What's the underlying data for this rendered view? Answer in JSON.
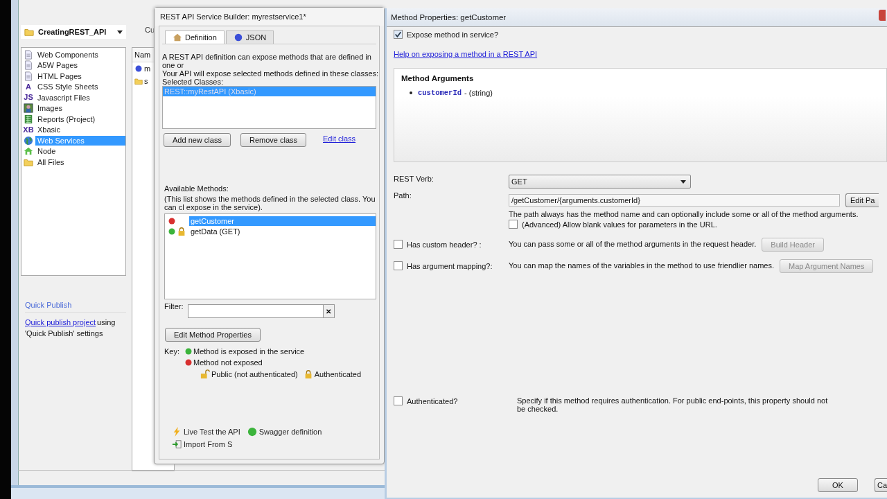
{
  "project": {
    "name": "CreatingREST_API",
    "column_tab": "Cu",
    "column_header": "Nam",
    "categories": [
      {
        "label": "Web Components",
        "kind": "page",
        "selected": false
      },
      {
        "label": "A5W Pages",
        "kind": "page",
        "selected": false
      },
      {
        "label": "HTML Pages",
        "kind": "page",
        "selected": false
      },
      {
        "label": "CSS Style Sheets",
        "kind": "glyph",
        "glyph": "A",
        "selected": false
      },
      {
        "label": "Javascript Files",
        "kind": "glyph",
        "glyph": "JS",
        "selected": false
      },
      {
        "label": "Images",
        "kind": "image",
        "selected": false
      },
      {
        "label": "Reports (Project)",
        "kind": "report",
        "selected": false
      },
      {
        "label": "Xbasic",
        "kind": "glyph",
        "glyph": "XB",
        "selected": false
      },
      {
        "label": "Web Services",
        "kind": "globe",
        "selected": true
      },
      {
        "label": "Node",
        "kind": "house",
        "selected": false
      },
      {
        "label": "All Files",
        "kind": "folder",
        "selected": false
      }
    ],
    "files": [
      {
        "label": "m",
        "kind": "service"
      },
      {
        "label": "s",
        "kind": "folder"
      }
    ],
    "quick_publish": {
      "title": "Quick Publish",
      "link": "Quick publish project",
      "text": "using",
      "note": "'Quick Publish' settings"
    }
  },
  "builder": {
    "title": "REST API Service Builder: myrestservice1*",
    "tabs": [
      {
        "label": "Definition",
        "kind": "house",
        "selected": true
      },
      {
        "label": "JSON",
        "kind": "ball",
        "selected": false
      }
    ],
    "intro": "A REST API definition can expose methods that are defined in one or",
    "intro2": "Your API will expose selected methods defined in these classes:",
    "classes_label": "Selected Classes:",
    "classes": [
      {
        "label": "REST::myRestAPI (Xbasic)",
        "selected": true
      }
    ],
    "class_buttons": [
      "Add new class",
      "Remove class"
    ],
    "edit_link": "Edit class",
    "methods_label": "Available Methods:",
    "methods_hint": "(This list shows the methods defined in the selected class. You can cl expose in the service).",
    "methods": [
      {
        "label": "getCustomer",
        "exposed": false,
        "authenticated": false,
        "selected": true
      },
      {
        "label": "getData (GET)",
        "exposed": true,
        "authenticated": true,
        "selected": false
      }
    ],
    "filter_label": "Filter:",
    "clear": "✕",
    "edit_button": "Edit Method Properties",
    "key_label": "Key:",
    "key": [
      {
        "kind": "exposed",
        "label": "Method is exposed in the service"
      },
      {
        "kind": "hidden",
        "label": "Method not exposed"
      },
      {
        "kind": "public",
        "label": "Public (not authenticated)"
      },
      {
        "kind": "authenticated",
        "label": "Authenticated"
      }
    ],
    "footer": [
      {
        "kind": "lightning",
        "label": "Live Test the API"
      },
      {
        "kind": "ball",
        "label": "Swagger definition"
      },
      {
        "kind": "import",
        "label": "Import From S"
      }
    ]
  },
  "dialog": {
    "title": "Method Properties: getCustomer",
    "expose": {
      "label": "Expose method in service?",
      "checked": true
    },
    "help_link": "Help on exposing a method in a REST API",
    "args_title": "Method Arguments",
    "arguments": [
      {
        "name": "customerId",
        "type": "- (string)"
      }
    ],
    "verb_label": "REST Verb:",
    "verb": "GET",
    "path_label": "Path:",
    "path": "/getCustomer/{arguments.customerId}",
    "path_button": "Edit Pa",
    "path_hint": "The path always has the method name and can optionally include some or all of the method arguments.",
    "advanced": {
      "label": "(Advanced) Allow blank values for parameters in the URL.",
      "checked": false
    },
    "options": [
      {
        "label": "Has custom header? :",
        "checked": false,
        "description": "You can pass some or all of the method arguments in the request header.",
        "button": "Build Header",
        "disabled": true
      },
      {
        "label": "Has argument mapping?:",
        "checked": false,
        "description": "You can map the names of the variables in the method to use friendlier names.",
        "button": "Map Argument Names",
        "disabled": true
      }
    ],
    "auth": {
      "label": "Authenticated?",
      "checked": false,
      "description": "Specify if this method requires authentication. For public end-points, this property should not be checked."
    },
    "buttons": [
      "OK",
      "Ca"
    ]
  }
}
